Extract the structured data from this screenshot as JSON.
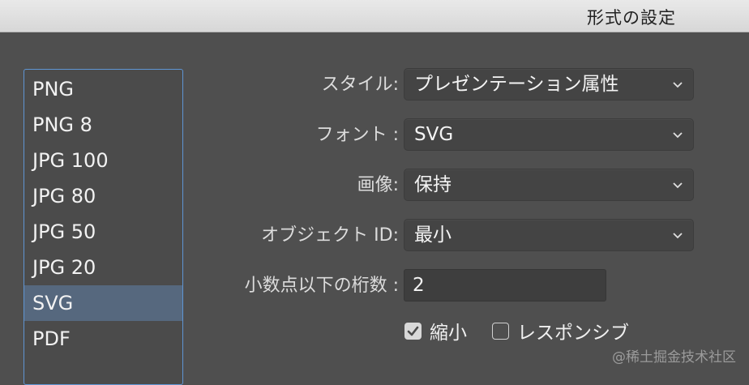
{
  "window": {
    "title": "形式の設定"
  },
  "format_list": {
    "items": [
      "PNG",
      "PNG 8",
      "JPG 100",
      "JPG 80",
      "JPG 50",
      "JPG 20",
      "SVG",
      "PDF"
    ],
    "selected": "SVG"
  },
  "options": {
    "style": {
      "label": "スタイル:",
      "value": "プレゼンテーション属性"
    },
    "font": {
      "label": "フォント :",
      "value": "SVG"
    },
    "image": {
      "label": "画像:",
      "value": "保持"
    },
    "object_id": {
      "label": "オブジェクト ID:",
      "value": "最小"
    },
    "decimals": {
      "label": "小数点以下の桁数 :",
      "value": "2"
    }
  },
  "checkboxes": {
    "minify": {
      "label": "縮小",
      "checked": true
    },
    "responsive": {
      "label": "レスポンシブ",
      "checked": false
    }
  },
  "watermark": "@稀土掘金技术社区",
  "colors": {
    "panel_bg": "#4f4f4f",
    "selection": "#56687e",
    "list_border": "#5f95d3"
  }
}
